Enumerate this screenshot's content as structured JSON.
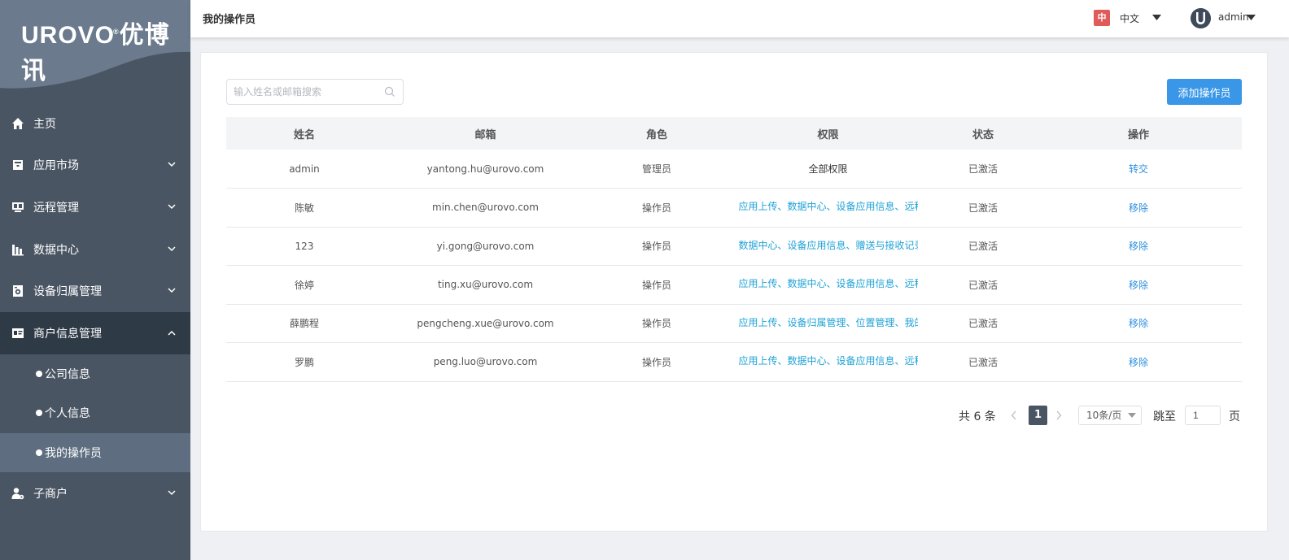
{
  "brand": {
    "logo_latin": "UROVO",
    "logo_cn": "优博讯"
  },
  "header": {
    "title": "我的操作员",
    "lang_badge": "中",
    "lang_label": "中文",
    "user": "admin"
  },
  "sidebar": {
    "items": [
      {
        "label": "主页",
        "icon": "home-icon"
      },
      {
        "label": "应用市场",
        "icon": "app-store-icon"
      },
      {
        "label": "远程管理",
        "icon": "remote-icon"
      },
      {
        "label": "数据中心",
        "icon": "chart-icon"
      },
      {
        "label": "设备归属管理",
        "icon": "device-icon"
      },
      {
        "label": "商户信息管理",
        "icon": "id-card-icon"
      },
      {
        "label": "子商户",
        "icon": "sub-merchant-icon"
      }
    ],
    "sub_items": [
      {
        "label": "公司信息"
      },
      {
        "label": "个人信息"
      },
      {
        "label": "我的操作员"
      }
    ]
  },
  "toolbar": {
    "search_placeholder": "输入姓名或邮箱搜索",
    "add_label": "添加操作员"
  },
  "table": {
    "headers": [
      "姓名",
      "邮箱",
      "角色",
      "权限",
      "状态",
      "操作"
    ],
    "rows": [
      {
        "name": "admin",
        "email": "yantong.hu@urovo.com",
        "role": "管理员",
        "perm": "全部权限",
        "status": "已激活",
        "action": "转交"
      },
      {
        "name": "陈敏",
        "email": "min.chen@urovo.com",
        "role": "操作员",
        "perm": "应用上传、数据中心、设备应用信息、远程",
        "status": "已激活",
        "action": "移除"
      },
      {
        "name": "123",
        "email": "yi.gong@urovo.com",
        "role": "操作员",
        "perm": "数据中心、设备应用信息、赠送与接收记录",
        "status": "已激活",
        "action": "移除"
      },
      {
        "name": "徐婷",
        "email": "ting.xu@urovo.com",
        "role": "操作员",
        "perm": "应用上传、数据中心、设备应用信息、远程",
        "status": "已激活",
        "action": "移除"
      },
      {
        "name": "薛鹏程",
        "email": "pengcheng.xue@urovo.com",
        "role": "操作员",
        "perm": "应用上传、设备归属管理、位置管理、我的",
        "status": "已激活",
        "action": "移除"
      },
      {
        "name": "罗鹏",
        "email": "peng.luo@urovo.com",
        "role": "操作员",
        "perm": "应用上传、数据中心、设备应用信息、远程",
        "status": "已激活",
        "action": "移除"
      }
    ]
  },
  "pagination": {
    "total": "共 6 条",
    "current": "1",
    "page_size": "10条/页",
    "jump_label": "跳至",
    "jump_value": "1",
    "page_suffix": "页"
  },
  "colors": {
    "sidebar": "#4a5563",
    "accent": "#3a97e8",
    "link": "#2f8fdf",
    "perm": "#1fa2d6"
  }
}
